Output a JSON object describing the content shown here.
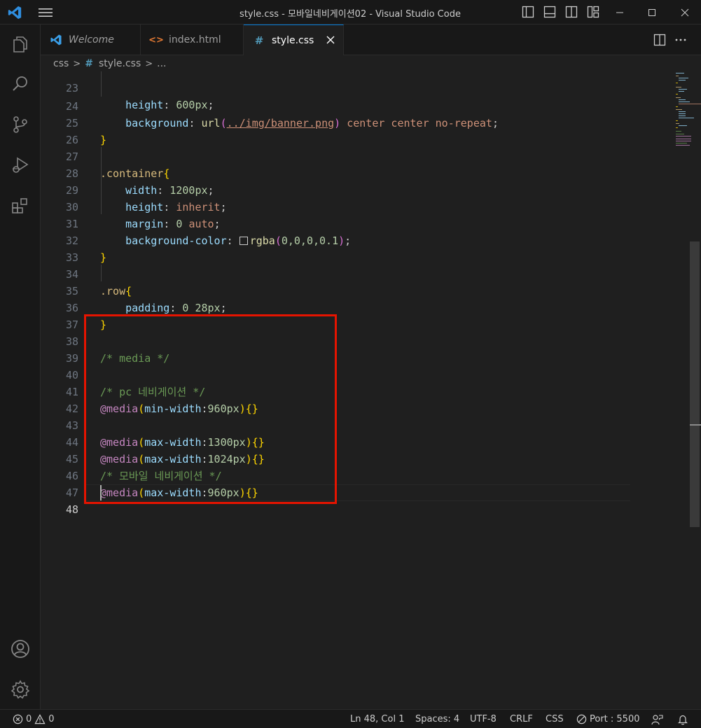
{
  "window": {
    "title": "style.css - 모바일네비게이션02 - Visual Studio Code"
  },
  "icons": {
    "app": "vscode-logo-icon",
    "menu": "hamburger-menu-icon",
    "layout": [
      "toggle-primary-sidebar-icon",
      "toggle-panel-icon",
      "toggle-secondary-sidebar-icon",
      "customize-layout-icon"
    ],
    "window_controls": [
      "minimize-icon",
      "maximize-icon",
      "close-icon"
    ],
    "activity": [
      "explorer-icon",
      "search-icon",
      "source-control-icon",
      "run-debug-icon",
      "extensions-icon",
      "accounts-icon",
      "settings-gear-icon"
    ]
  },
  "tabs": [
    {
      "label": "Welcome",
      "icon": "vscode-icon",
      "active": false
    },
    {
      "label": "index.html",
      "icon": "html-icon",
      "active": false
    },
    {
      "label": "style.css",
      "icon": "css-hash-icon",
      "active": true
    }
  ],
  "breadcrumb": {
    "folder": "css",
    "file": "style.css",
    "symbol": "..."
  },
  "editor": {
    "line_numbers": [
      "23",
      "24",
      "25",
      "26",
      "27",
      "28",
      "29",
      "30",
      "31",
      "32",
      "33",
      "34",
      "35",
      "36",
      "37",
      "38",
      "39",
      "40",
      "41",
      "42",
      "43",
      "44",
      "45",
      "46",
      "47",
      "48"
    ],
    "current_line": "48",
    "code": {
      "l23_prop": "height",
      "l23_val": "600px",
      "l24_prop": "background",
      "l24_fn": "url",
      "l24_url": "../img/banner.png",
      "l24_rest": "center center no-repeat",
      "l27_sel": ".container",
      "l28_prop": "width",
      "l28_val": "1200px",
      "l29_prop": "height",
      "l29_val": "inherit",
      "l30_prop": "margin",
      "l30_num": "0",
      "l30_val": "auto",
      "l31_prop": "background-color",
      "l31_fn": "rgba",
      "l31_args": "0,0,0,0.1",
      "l34_sel": ".row",
      "l35_prop": "padding",
      "l35_val": "0 28px",
      "l38_cmt": "/* media */",
      "l40_cmt": "/* pc 네비게이션 */",
      "l41_at": "@media",
      "l41_feat": "min-width",
      "l41_val": "960px",
      "l43_at": "@media",
      "l43_feat": "max-width",
      "l43_val": "1300px",
      "l44_at": "@media",
      "l44_feat": "max-width",
      "l44_val": "1024px",
      "l45_cmt": "/* 모바일 네비게이션 */",
      "l46_at": "@media",
      "l46_feat": "max-width",
      "l46_val": "960px"
    }
  },
  "status": {
    "errors": "0",
    "warnings": "0",
    "position": "Ln 48, Col 1",
    "spaces": "Spaces: 4",
    "encoding": "UTF-8",
    "eol": "CRLF",
    "language": "CSS",
    "port": "Port : 5500"
  },
  "colors": {
    "highlight_box": "#e51400",
    "accent": "#0078d4"
  }
}
